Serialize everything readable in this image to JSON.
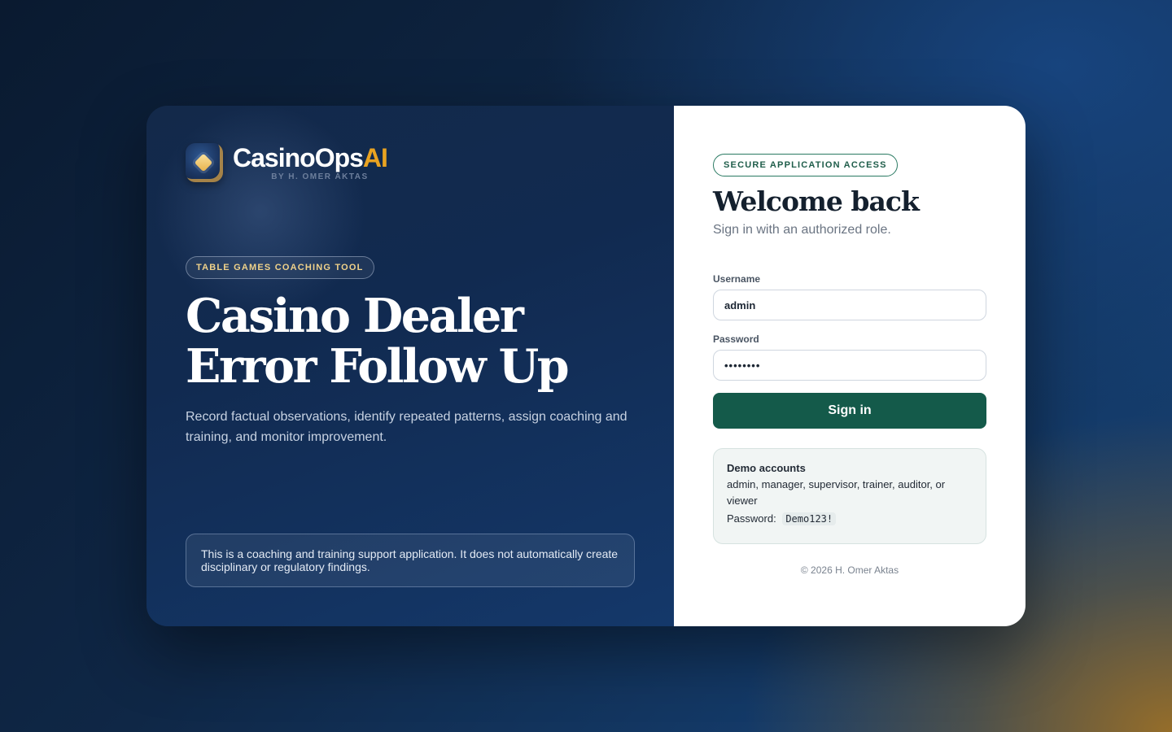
{
  "brand": {
    "name_main": "CasinoOps",
    "name_accent": "AI",
    "byline": "BY H. OMER AKTAS",
    "accent_color": "#e9a321"
  },
  "hero": {
    "tag": "TABLE GAMES COACHING TOOL",
    "headline_line1": "Casino Dealer",
    "headline_line2": "Error Follow Up",
    "description": "Record factual observations, identify repeated patterns, assign coaching and training, and monitor improvement.",
    "disclaimer": "This is a coaching and training support application. It does not automatically create disciplinary or regulatory findings."
  },
  "login": {
    "tag": "SECURE APPLICATION ACCESS",
    "title": "Welcome back",
    "subtitle": "Sign in with an authorized role.",
    "username_label": "Username",
    "username_value": "admin",
    "password_label": "Password",
    "password_value": "••••••••",
    "submit_label": "Sign in",
    "button_color": "#145a4a"
  },
  "demo": {
    "title": "Demo accounts",
    "roles": "admin, manager, supervisor, trainer, auditor, or viewer",
    "password_label": "Password:",
    "password_value": "Demo123!"
  },
  "footer": {
    "copyright": "© 2026 H. Omer Aktas"
  }
}
